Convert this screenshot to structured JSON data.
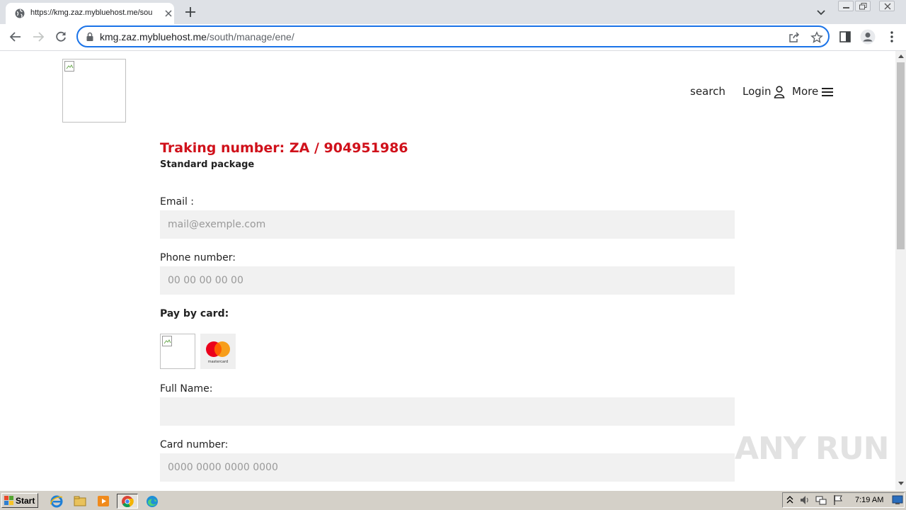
{
  "browser": {
    "tab_title": "https://kmg.zaz.mybluehost.me/sou",
    "url_host": "kmg.zaz.mybluehost.me",
    "url_path": "/south/manage/ene/",
    "accent": "#1a73e8"
  },
  "header": {
    "search_label": "search",
    "login_label": "Login",
    "more_label": "More"
  },
  "page": {
    "tracking_title": "Traking number: ZA / 904951986",
    "package_type": "Standard package",
    "title_color": "#d0111b"
  },
  "form": {
    "email_label": "Email :",
    "email_placeholder": "mail@exemple.com",
    "phone_label": "Phone number:",
    "phone_placeholder": "00 00 00 00 00",
    "pay_label": "Pay by card:",
    "mastercard_text": "mastercard",
    "fullname_label": "Full Name:",
    "fullname_placeholder": "",
    "card_label": "Card number:",
    "card_placeholder": "0000 0000 0000 0000"
  },
  "watermark": "ANY RUN",
  "taskbar": {
    "start_label": "Start",
    "clock": "7:19 AM"
  }
}
